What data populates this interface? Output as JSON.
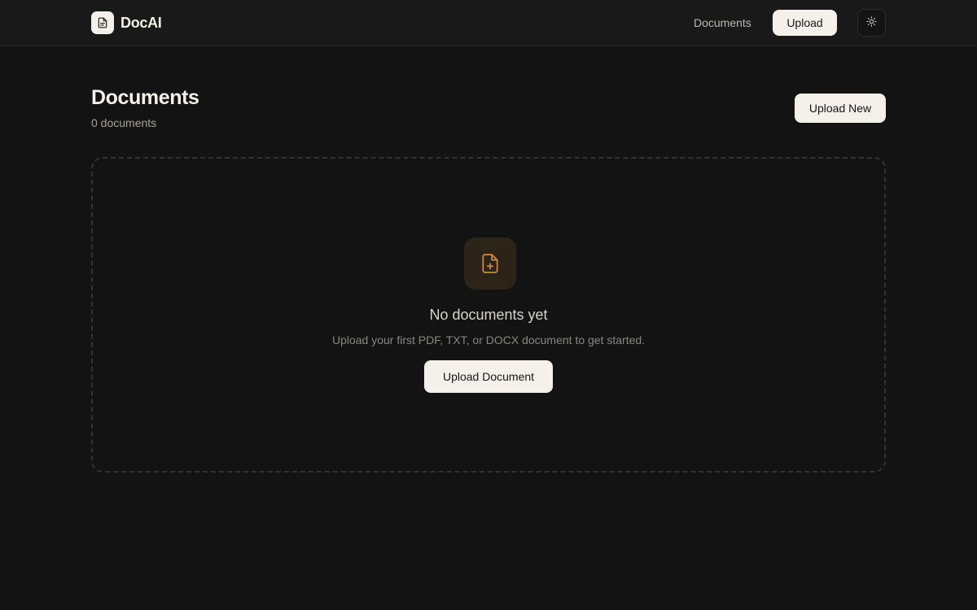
{
  "brand": {
    "name": "DocAI",
    "icon": "file-text-icon"
  },
  "nav": {
    "documents_label": "Documents",
    "upload_label": "Upload",
    "theme_icon": "sun-icon"
  },
  "page": {
    "title": "Documents",
    "count_text": "0 documents",
    "upload_new_label": "Upload New"
  },
  "empty_state": {
    "icon": "file-plus-icon",
    "title": "No documents yet",
    "description": "Upload your first PDF, TXT, or DOCX document to get started.",
    "button_label": "Upload Document"
  },
  "colors": {
    "background": "#131313",
    "header": "#191919",
    "button_bg": "#f5f1ea",
    "accent": "#d08a3c"
  }
}
